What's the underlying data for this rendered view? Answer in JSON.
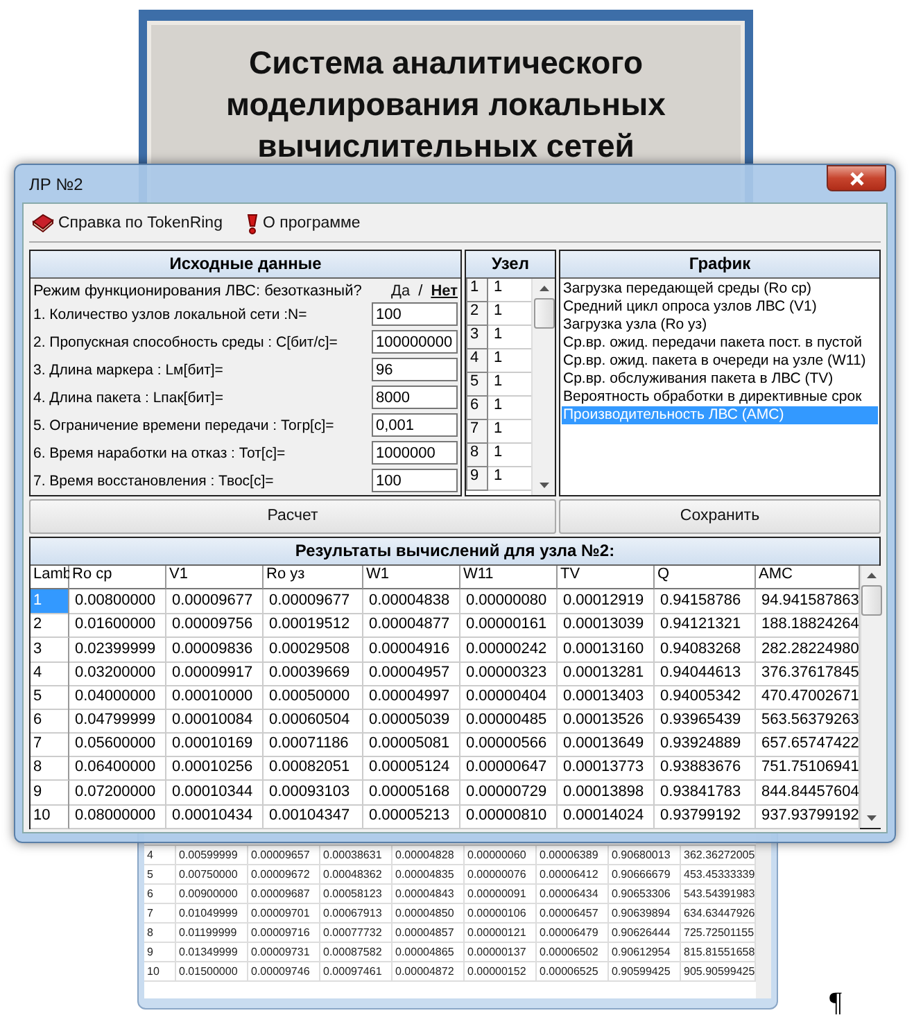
{
  "background_slide": {
    "title_lines": [
      "Система аналитического",
      "моделирования локальных",
      "вычислительных сетей"
    ]
  },
  "background_table": {
    "rows": [
      [
        "4",
        "0.00599999",
        "0.00009657",
        "0.00038631",
        "0.00004828",
        "0.00000060",
        "0.00006389",
        "0.90680013",
        "362.36272005"
      ],
      [
        "5",
        "0.00750000",
        "0.00009672",
        "0.00048362",
        "0.00004835",
        "0.00000076",
        "0.00006412",
        "0.90666679",
        "453.45333339"
      ],
      [
        "6",
        "0.00900000",
        "0.00009687",
        "0.00058123",
        "0.00004843",
        "0.00000091",
        "0.00006434",
        "0.90653306",
        "543.54391983"
      ],
      [
        "7",
        "0.01049999",
        "0.00009701",
        "0.00067913",
        "0.00004850",
        "0.00000106",
        "0.00006457",
        "0.90639894",
        "634.63447926"
      ],
      [
        "8",
        "0.01199999",
        "0.00009716",
        "0.00077732",
        "0.00004857",
        "0.00000121",
        "0.00006479",
        "0.90626444",
        "725.72501155"
      ],
      [
        "9",
        "0.01349999",
        "0.00009731",
        "0.00087582",
        "0.00004865",
        "0.00000137",
        "0.00006502",
        "0.90612954",
        "815.81551658"
      ],
      [
        "10",
        "0.01500000",
        "0.00009746",
        "0.00097461",
        "0.00004872",
        "0.00000152",
        "0.00006525",
        "0.90599425",
        "905.90599425"
      ]
    ]
  },
  "paragraph_mark": "¶",
  "dialog": {
    "title": "ЛР №2",
    "menu": [
      {
        "label": "Справка по TokenRing",
        "kind": "help"
      },
      {
        "label": "О программе",
        "kind": "about"
      }
    ],
    "input_panel": {
      "title": "Исходные данные",
      "mode_label": "Режим функционирования ЛВС: безотказный?",
      "mode_options": [
        {
          "label": "Да",
          "selected": false
        },
        {
          "label": "Нет",
          "selected": true
        }
      ],
      "separator": "/",
      "params": [
        {
          "label": "1. Количество узлов локальной сети :N=",
          "value": "100"
        },
        {
          "label": "2. Пропускная способность среды : С[бит/с]=",
          "value": "100000000"
        },
        {
          "label": "3. Длина маркера : Lм[бит]=",
          "value": "96"
        },
        {
          "label": "4. Длина пакета : Lпак[бит]=",
          "value": "8000"
        },
        {
          "label": "5. Ограничение времени передачи : Тогр[с]=",
          "value": "0,001"
        },
        {
          "label": "6. Время наработки на отказ : Тот[с]=",
          "value": "1000000"
        },
        {
          "label": "7. Время восстановления : Твос[с]=",
          "value": "100"
        }
      ]
    },
    "node_panel": {
      "title": "Узел",
      "rows": [
        {
          "number": "1",
          "value": "1"
        },
        {
          "number": "2",
          "value": "1"
        },
        {
          "number": "3",
          "value": "1"
        },
        {
          "number": "4",
          "value": "1"
        },
        {
          "number": "5",
          "value": "1"
        },
        {
          "number": "6",
          "value": "1"
        },
        {
          "number": "7",
          "value": "1"
        },
        {
          "number": "8",
          "value": "1"
        },
        {
          "number": "9",
          "value": "1"
        }
      ]
    },
    "chart_panel": {
      "title": "График",
      "items": [
        {
          "label": "Загрузка передающей среды (Ro ср)",
          "selected": false
        },
        {
          "label": "Средний цикл опроса узлов ЛВС (V1)",
          "selected": false
        },
        {
          "label": "Загрузка узла (Ro уз)",
          "selected": false
        },
        {
          "label": "Ср.вр. ожид. передачи пакета пост. в пустой",
          "selected": false
        },
        {
          "label": "Ср.вр. ожид. пакета в очереди на узле (W11)",
          "selected": false
        },
        {
          "label": "Ср.вр. обслуживания пакета в ЛВС (TV)",
          "selected": false
        },
        {
          "label": "Вероятность обработки в директивные срок",
          "selected": false
        },
        {
          "label": "Производительность ЛВС (АМС)",
          "selected": true
        }
      ]
    },
    "buttons": [
      "Расчет",
      "Сохранить"
    ],
    "results": {
      "title": "Результаты вычислений для узла №2:",
      "columns": [
        "Lamb",
        "Ro cp",
        "V1",
        "Ro уз",
        "W1",
        "W11",
        "TV",
        "Q",
        "AMC"
      ],
      "rows": [
        {
          "selected": true,
          "cells": [
            "1",
            "0.00800000",
            "0.00009677",
            "0.00009677",
            "0.00004838",
            "0.00000080",
            "0.00012919",
            "0.94158786",
            "94.941587863"
          ]
        },
        {
          "selected": false,
          "cells": [
            "2",
            "0.01600000",
            "0.00009756",
            "0.00019512",
            "0.00004877",
            "0.00000161",
            "0.00013039",
            "0.94121321",
            "188.18824264"
          ]
        },
        {
          "selected": false,
          "cells": [
            "3",
            "0.02399999",
            "0.00009836",
            "0.00029508",
            "0.00004916",
            "0.00000242",
            "0.00013160",
            "0.94083268",
            "282.28224980"
          ]
        },
        {
          "selected": false,
          "cells": [
            "4",
            "0.03200000",
            "0.00009917",
            "0.00039669",
            "0.00004957",
            "0.00000323",
            "0.00013281",
            "0.94044613",
            "376.37617845"
          ]
        },
        {
          "selected": false,
          "cells": [
            "5",
            "0.04000000",
            "0.00010000",
            "0.00050000",
            "0.00004997",
            "0.00000404",
            "0.00013403",
            "0.94005342",
            "470.47002671"
          ]
        },
        {
          "selected": false,
          "cells": [
            "6",
            "0.04799999",
            "0.00010084",
            "0.00060504",
            "0.00005039",
            "0.00000485",
            "0.00013526",
            "0.93965439",
            "563.56379263"
          ]
        },
        {
          "selected": false,
          "cells": [
            "7",
            "0.05600000",
            "0.00010169",
            "0.00071186",
            "0.00005081",
            "0.00000566",
            "0.00013649",
            "0.93924889",
            "657.65747422"
          ]
        },
        {
          "selected": false,
          "cells": [
            "8",
            "0.06400000",
            "0.00010256",
            "0.00082051",
            "0.00005124",
            "0.00000647",
            "0.00013773",
            "0.93883676",
            "751.75106941"
          ]
        },
        {
          "selected": false,
          "cells": [
            "9",
            "0.07200000",
            "0.00010344",
            "0.00093103",
            "0.00005168",
            "0.00000729",
            "0.00013898",
            "0.93841783",
            "844.84457604"
          ]
        },
        {
          "selected": false,
          "cells": [
            "10",
            "0.08000000",
            "0.00010434",
            "0.00104347",
            "0.00005213",
            "0.00000810",
            "0.00014024",
            "0.93799192",
            "937.93799192"
          ]
        }
      ]
    }
  }
}
